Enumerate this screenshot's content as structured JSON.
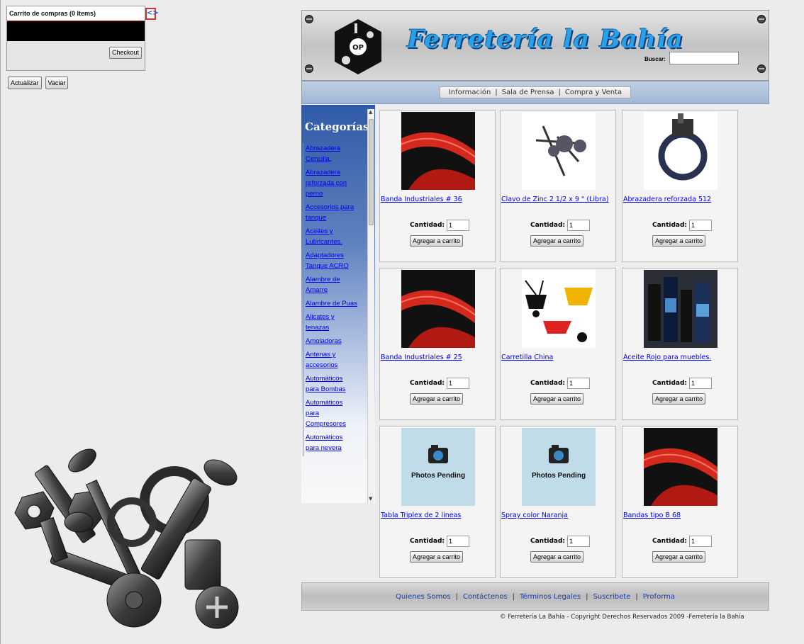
{
  "cart": {
    "header": "Carrito de compras (0 Items)",
    "checkout_label": "Checkout",
    "update_label": "Actualizar",
    "empty_label": "Vaciar",
    "toggle_icon": "<>"
  },
  "site": {
    "title": "Ferretería la Bahía",
    "search_label": "Buscar:",
    "search_value": ""
  },
  "nav": {
    "items": [
      "Información",
      "Sala de Prensa",
      "Compra y Venta"
    ],
    "separator": "|"
  },
  "sidebar": {
    "title": "Categorías",
    "items": [
      [
        "Abrazadera",
        "Cencilla."
      ],
      [
        "Abrazadera",
        "reforzada con",
        "perno"
      ],
      [
        "Accesorios para",
        "tanque"
      ],
      [
        "Aceites y",
        "Lubricantes."
      ],
      [
        "Adaptadores",
        "Tanque ACRO"
      ],
      [
        "Alambre de",
        "Amarre"
      ],
      [
        "Alambre de Puas"
      ],
      [
        "Alicates y",
        "tenazas"
      ],
      [
        "Amoladoras"
      ],
      [
        "Antenas y",
        "accesorios"
      ],
      [
        "Automáticos",
        "para Bombas"
      ],
      [
        "Automáticos",
        "para",
        "Compresores"
      ],
      [
        "Automáticos",
        "para nevera"
      ]
    ]
  },
  "products": [
    {
      "name": "Banda Industriales # 36",
      "qty_label": "Cantidad:",
      "qty": "1",
      "button": "Agregar a carrito",
      "image": "red-band-icon"
    },
    {
      "name": "Clavo de Zinc 2 1/2 x 9 \" (Libra)",
      "qty_label": "Cantidad:",
      "qty": "1",
      "button": "Agregar a carrito",
      "image": "nails-icon"
    },
    {
      "name": "Abrazadera reforzada 512",
      "qty_label": "Cantidad:",
      "qty": "1",
      "button": "Agregar a carrito",
      "image": "clamp-icon"
    },
    {
      "name": "Banda Industriales # 25",
      "qty_label": "Cantidad:",
      "qty": "1",
      "button": "Agregar a carrito",
      "image": "red-band-icon"
    },
    {
      "name": "Carretilla China",
      "qty_label": "Cantidad:",
      "qty": "1",
      "button": "Agregar a carrito",
      "image": "wheelbarrow-icon"
    },
    {
      "name": "Aceite Rojo para muebles.",
      "qty_label": "Cantidad:",
      "qty": "1",
      "button": "Agregar a carrito",
      "image": "oil-bottles-icon"
    },
    {
      "name": "Tabla Triplex de 2 lineas",
      "qty_label": "Cantidad:",
      "qty": "1",
      "button": "Agregar a carrito",
      "image": "photos-pending-icon",
      "pending_text": "Photos Pending"
    },
    {
      "name": "Spray color Naranja",
      "qty_label": "Cantidad:",
      "qty": "1",
      "button": "Agregar a carrito",
      "image": "photos-pending-icon",
      "pending_text": "Photos Pending"
    },
    {
      "name": "Bandas tipo B 68",
      "qty_label": "Cantidad:",
      "qty": "1",
      "button": "Agregar a carrito",
      "image": "red-band-icon"
    }
  ],
  "footer": {
    "links": [
      "Quienes Somos",
      "Contáctenos",
      "Términos Legales",
      "Suscribete",
      "Proforma"
    ],
    "separator": "|",
    "copyright": "© Ferretería La Bahía - Copyright Derechos Reservados 2009 -Ferretería la Bahía"
  },
  "colors": {
    "link": "#0000ee",
    "title_blue": "#2aa0e8",
    "sidebar_blue": "#2f5aa6"
  }
}
